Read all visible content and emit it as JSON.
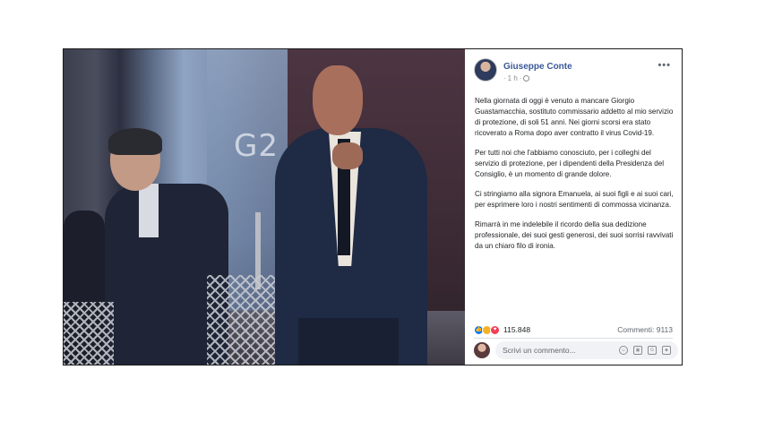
{
  "photo": {
    "sign_text": "G2"
  },
  "post": {
    "author": "Giuseppe Conte",
    "time": "1 h",
    "menu_icon": "ellipsis-icon",
    "paragraphs": [
      "Nella giornata di oggi è venuto a mancare Giorgio Guastamacchia, sostituto commissario addetto al mio servizio di protezione, di soli 51 anni. Nei giorni scorsi era stato ricoverato a Roma dopo aver contratto il virus Covid-19.",
      "Per tutti noi che l'abbiamo conosciuto, per i colleghi del servizio di protezione, per i dipendenti della Presidenza del Consiglio, è un momento di grande dolore.",
      "Ci stringiamo alla signora Emanuela, ai suoi figli e ai suoi cari, per esprimere loro i nostri sentimenti di commossa vicinanza.",
      "Rimarrà in me indelebile il ricordo della sua dedizione professionale, dei suoi gesti generosi, dei suoi sorrisi ravvivati da un chiaro filo di ironia."
    ],
    "reactions": {
      "count": "115.848",
      "comments": "Commenti: 9113",
      "icons": [
        "like-icon",
        "sad-icon",
        "love-icon"
      ]
    },
    "comment_box": {
      "placeholder": "Scrivi un commento..."
    }
  },
  "colors": {
    "author_link": "#385898",
    "like": "#1877f2",
    "love": "#f33e58",
    "sad": "#f7b125"
  }
}
